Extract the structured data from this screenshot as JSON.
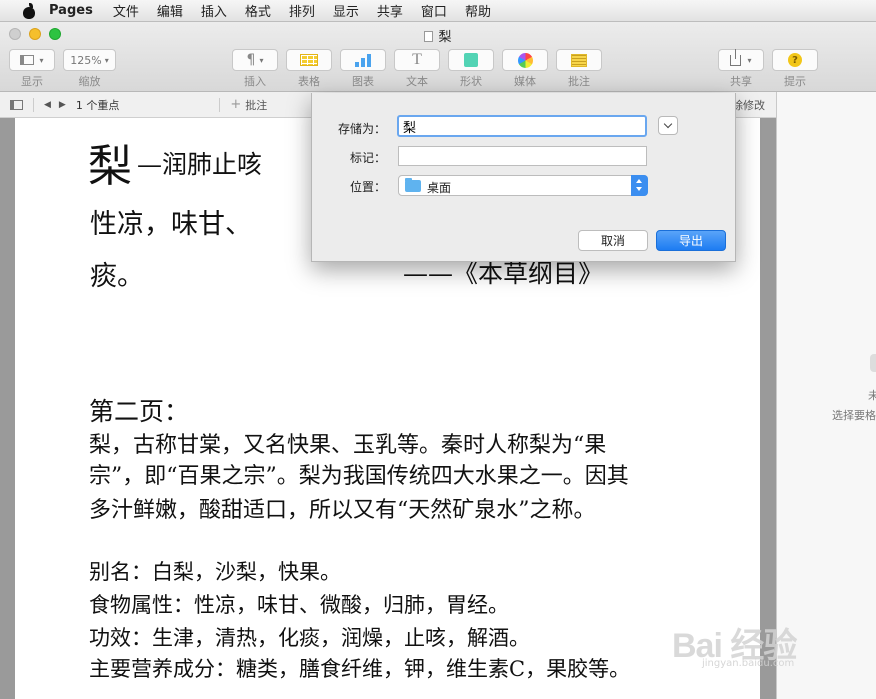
{
  "menubar": {
    "app": "Pages",
    "items": [
      "文件",
      "编辑",
      "插入",
      "格式",
      "排列",
      "显示",
      "共享",
      "窗口",
      "帮助"
    ]
  },
  "window": {
    "title": "梨"
  },
  "toolbar": {
    "view_label": "显示",
    "zoom_value": "125%",
    "zoom_label": "缩放",
    "insert_label": "插入",
    "table_label": "表格",
    "chart_label": "图表",
    "text_label": "文本",
    "shape_label": "形状",
    "media_label": "媒体",
    "comment_label": "批注",
    "share_label": "共享",
    "tips_label": "提示"
  },
  "formatbar": {
    "highlight_count": "1 个重点",
    "comment": "批注",
    "track_changes": "除修改"
  },
  "document": {
    "title_big": "梨",
    "title_rest": "—润肺止咳",
    "line1_part": "性凉，味甘、",
    "line2_start": "痰。",
    "citation": "——《本草纲目》",
    "section_heading": "第二页：",
    "para1": [
      "梨，古称甘棠，又名快果、玉乳等。秦时人称梨为“果",
      "宗”，即“百果之宗”。梨为我国传统四大水果之一。因其",
      "多汁鲜嫩，酸甜适口，所以又有“天然矿泉水”之称。"
    ],
    "para2": [
      "别名：白梨，沙梨，快果。",
      "食物属性：性凉，味甘、微酸，归肺，胃经。",
      "功效：生津，清热，化痰，润燥，止咳，解酒。",
      "主要营养成分：糖类，膳食纤维，钾，维生素C，果胶等。"
    ]
  },
  "right_panel": {
    "line1": "未",
    "line2": "选择要格"
  },
  "dialog": {
    "saveas_label": "存储为：",
    "saveas_value": "梨",
    "tags_label": "标记：",
    "tags_value": "",
    "where_label": "位置：",
    "where_value": "桌面",
    "cancel_label": "取消",
    "export_label": "导出"
  },
  "watermark": {
    "logo": "Bai 经验",
    "url": "jingyan.baidu.com"
  },
  "colors": {
    "accent": "#1d7cf2",
    "folder": "#5fb3ef"
  }
}
